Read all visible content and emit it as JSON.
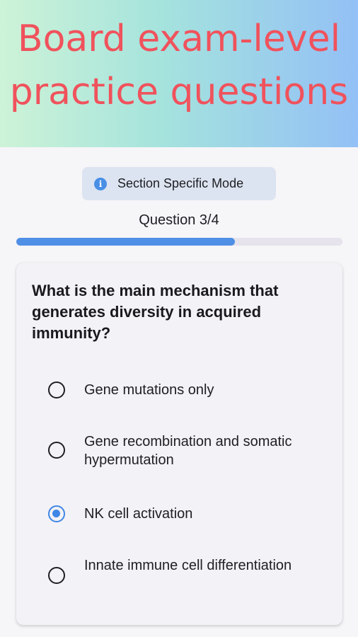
{
  "promo": {
    "headline_line1": "Board exam-level",
    "headline_line2": "practice questions"
  },
  "mode": {
    "label": "Section Specific Mode",
    "icon": "info-icon",
    "chip_color": "#dce4f1",
    "accent": "#4a8fe6"
  },
  "progress": {
    "label": "Question 3/4",
    "current": 3,
    "total": 4,
    "fill_fraction": 0.67,
    "fill_color": "#4f8fe6"
  },
  "question": {
    "text": "What is the main mechanism that generates diversity in acquired immunity?",
    "options": [
      {
        "label": "Gene mutations only",
        "selected": false
      },
      {
        "label": "Gene recombination and somatic hypermutation",
        "selected": false
      },
      {
        "label": "NK cell activation",
        "selected": true
      },
      {
        "label": "Innate immune cell differentiation",
        "selected": false
      }
    ]
  }
}
